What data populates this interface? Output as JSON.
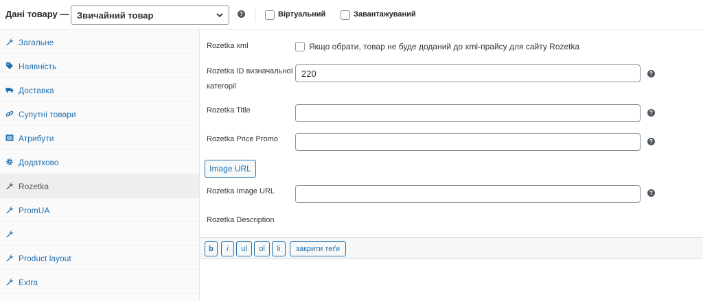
{
  "header": {
    "title": "Дані товару —",
    "product_type": "Звичайний товар",
    "help_glyph": "?",
    "virtual_label": "Віртуальний",
    "downloadable_label": "Завантажуваний"
  },
  "tabs": [
    {
      "label": "Загальне",
      "icon": "wrench-icon",
      "active": false
    },
    {
      "label": "Наявність",
      "icon": "tag-icon",
      "active": false
    },
    {
      "label": "Доставка",
      "icon": "truck-icon",
      "active": false
    },
    {
      "label": "Супутні товари",
      "icon": "link-icon",
      "active": false
    },
    {
      "label": "Атрибути",
      "icon": "list-icon",
      "active": false
    },
    {
      "label": "Додатково",
      "icon": "gear-icon",
      "active": false
    },
    {
      "label": "Rozetka",
      "icon": "wrench-icon",
      "active": true
    },
    {
      "label": "PromUA",
      "icon": "wrench-icon",
      "active": false
    },
    {
      "label": "",
      "icon": "wrench-icon",
      "active": false
    },
    {
      "label": "Product layout",
      "icon": "wrench-icon",
      "active": false
    },
    {
      "label": "Extra",
      "icon": "wrench-icon",
      "active": false
    }
  ],
  "form": {
    "xml_label": "Rozetka xml",
    "xml_desc": "Якщо обрати, товар не буде доданий до xml-прайсу для сайту Rozetka",
    "category_label_1": "Rozetka ID визначальної",
    "category_label_2": "категорії",
    "category_value": "220",
    "title_label": "Rozetka Title",
    "title_value": "",
    "price_label": "Rozetka Price Promo",
    "price_value": "",
    "image_button": "Image URL",
    "image_label": "Rozetka Image URL",
    "image_value": "",
    "description_label": "Rozetka Description"
  },
  "quicktags": [
    "b",
    "i",
    "ul",
    "ol",
    "li",
    "закрити теґи"
  ],
  "colors": {
    "accent": "#2271b1",
    "active_tab_bg": "#eeeeee",
    "help_icon": "#50575e"
  }
}
